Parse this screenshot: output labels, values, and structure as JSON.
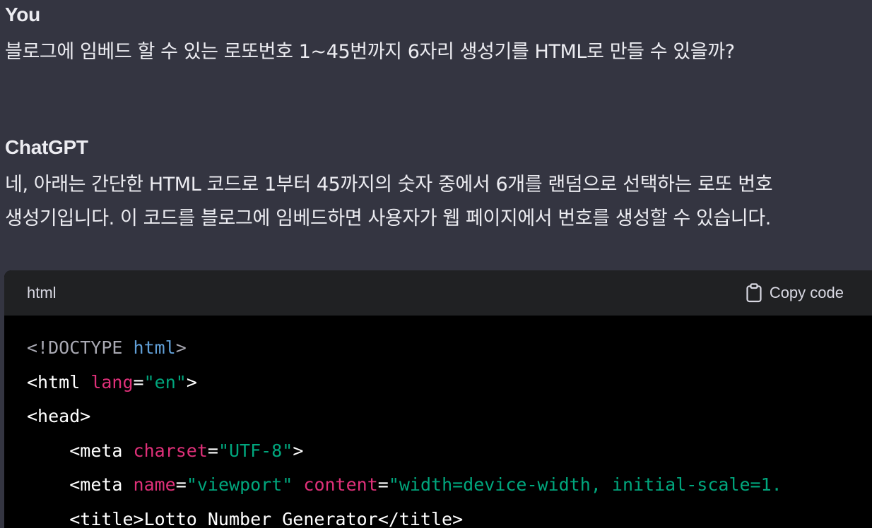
{
  "conversation": {
    "user": {
      "author": "You",
      "text": "블로그에 임베드 할 수 있는 로또번호 1~45번까지 6자리 생성기를 HTML로 만들 수 있을까?"
    },
    "assistant": {
      "author": "ChatGPT",
      "paragraph_lines": [
        "네, 아래는 간단한 HTML 코드로 1부터 45까지의 숫자 중에서 6개를 랜덤으로 선택하는 로또 번호",
        "생성기입니다. 이 코드를 블로그에 임베드하면 사용자가 웹 페이지에서 번호를 생성할 수 있습니다."
      ]
    }
  },
  "code_block": {
    "language": "html",
    "copy_label": "Copy code",
    "copy_icon": "clipboard-icon",
    "lines": [
      {
        "indent": "",
        "tokens": [
          {
            "c": "t-gray",
            "t": "<!DOCTYPE "
          },
          {
            "c": "t-blue",
            "t": "html"
          },
          {
            "c": "t-gray",
            "t": ">"
          }
        ]
      },
      {
        "indent": "",
        "tokens": [
          {
            "c": "t-white",
            "t": "<html "
          },
          {
            "c": "t-attr",
            "t": "lang"
          },
          {
            "c": "t-white",
            "t": "="
          },
          {
            "c": "t-str",
            "t": "\"en\""
          },
          {
            "c": "t-white",
            "t": ">"
          }
        ]
      },
      {
        "indent": "",
        "tokens": [
          {
            "c": "t-white",
            "t": "<head>"
          }
        ]
      },
      {
        "indent": "    ",
        "tokens": [
          {
            "c": "t-white",
            "t": "<meta "
          },
          {
            "c": "t-attr",
            "t": "charset"
          },
          {
            "c": "t-white",
            "t": "="
          },
          {
            "c": "t-str",
            "t": "\"UTF-8\""
          },
          {
            "c": "t-white",
            "t": ">"
          }
        ]
      },
      {
        "indent": "    ",
        "tokens": [
          {
            "c": "t-white",
            "t": "<meta "
          },
          {
            "c": "t-attr",
            "t": "name"
          },
          {
            "c": "t-white",
            "t": "="
          },
          {
            "c": "t-str",
            "t": "\"viewport\""
          },
          {
            "c": "t-white",
            "t": " "
          },
          {
            "c": "t-attr",
            "t": "content"
          },
          {
            "c": "t-white",
            "t": "="
          },
          {
            "c": "t-str",
            "t": "\"width=device-width, initial-scale=1."
          }
        ]
      },
      {
        "indent": "    ",
        "tokens": [
          {
            "c": "t-white",
            "t": "<title>Lotto Number Generator</title>"
          }
        ]
      }
    ]
  }
}
